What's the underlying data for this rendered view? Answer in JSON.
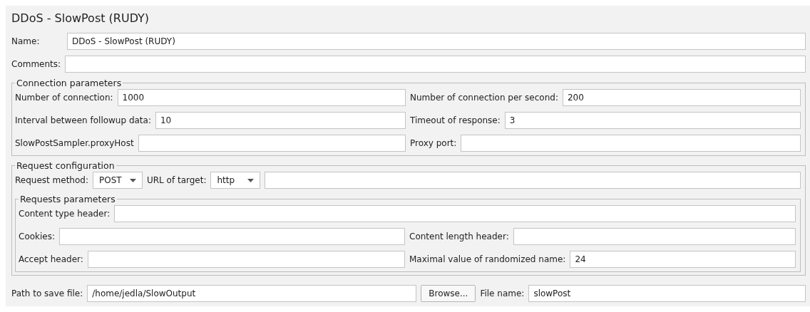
{
  "title": "DDoS - SlowPost (RUDY)",
  "name_field": {
    "label": "Name:",
    "value": "DDoS - SlowPost (RUDY)"
  },
  "comments_field": {
    "label": "Comments:"
  },
  "connection_parameters": {
    "title": "Connection parameters",
    "rows": [
      [
        {
          "label": "Number of connection:",
          "value": "1000"
        },
        {
          "label": "Number of connection per second:",
          "value": "200"
        }
      ],
      [
        {
          "label": "Interval between followup data:",
          "value": "10"
        },
        {
          "label": "Timeout of response:",
          "value": "3"
        }
      ],
      [
        {
          "label": "SlowPostSampler.proxyHost"
        },
        {
          "label": "Proxy port:"
        }
      ]
    ]
  },
  "request_configuration": {
    "title": "Request configuration",
    "method": {
      "label": "Request method:",
      "value": "POST"
    },
    "url": {
      "label": "URL of target:",
      "protocol": "http"
    },
    "requests_parameters": {
      "title": "Requests parameters",
      "rows": [
        [
          {
            "label": "Content type header:"
          }
        ],
        [
          {
            "label": "Cookies:"
          },
          {
            "label": "Content length header:"
          }
        ],
        [
          {
            "label": "Accept header:"
          },
          {
            "label": "Maximal value of randomized name:",
            "value": "24"
          }
        ]
      ]
    }
  },
  "save": {
    "path_label": "Path to save file:",
    "path": "/home/jedla/SlowOutput",
    "browse_button": "Browse...",
    "file_label": "File name:",
    "file_name": "slowPost"
  }
}
